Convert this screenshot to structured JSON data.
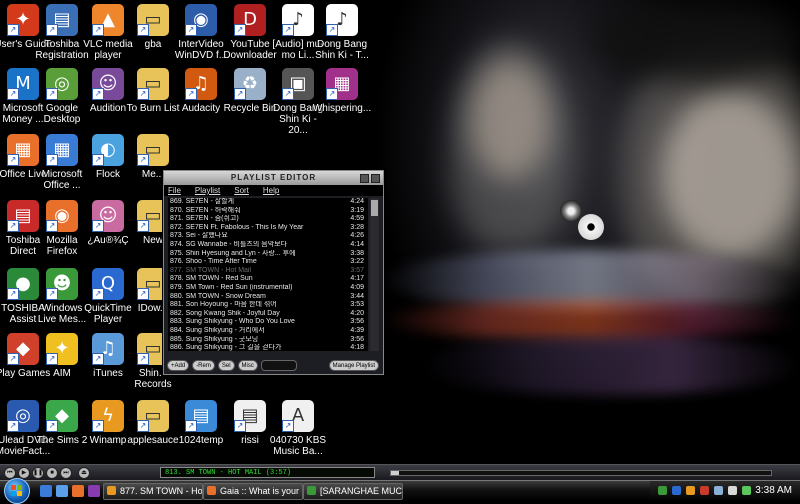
{
  "desktop": {
    "icons": [
      {
        "label": "User's Guide",
        "color": "#d33a1c",
        "glyph": "✦"
      },
      {
        "label": "Toshiba Registration",
        "color": "#3a6fb5",
        "glyph": "▤"
      },
      {
        "label": "VLC media player",
        "color": "#f0862b",
        "glyph": "▲"
      },
      {
        "label": "gba",
        "color": "#e7c35a",
        "glyph": "▭"
      },
      {
        "label": "InterVideo WinDVD f...",
        "color": "#2d5ca8",
        "glyph": "◉"
      },
      {
        "label": "YouTube Downloader",
        "color": "#b02020",
        "glyph": "D"
      },
      {
        "label": "[Audio] mu-mo Li...",
        "color": "#ffffff",
        "glyph": "♪"
      },
      {
        "label": "Dong Bang Shin Ki - T...",
        "color": "#ffffff",
        "glyph": "♪"
      },
      {
        "label": "Microsoft Money ...",
        "color": "#1a73c9",
        "glyph": "M"
      },
      {
        "label": "Google Desktop",
        "color": "#5a9e3a",
        "glyph": "◎"
      },
      {
        "label": "Audition",
        "color": "#7a4a9a",
        "glyph": "☺"
      },
      {
        "label": "To Burn List",
        "color": "#e7c35a",
        "glyph": "▭"
      },
      {
        "label": "Audacity",
        "color": "#d25a10",
        "glyph": "♫"
      },
      {
        "label": "Recycle Bin",
        "color": "#9ab0c8",
        "glyph": "♻"
      },
      {
        "label": "Dong Bang Shin Ki - 20...",
        "color": "#555555",
        "glyph": "▣"
      },
      {
        "label": "Whispering...",
        "color": "#a0308a",
        "glyph": "▦"
      },
      {
        "label": "Office Live",
        "color": "#e8702a",
        "glyph": "▦"
      },
      {
        "label": "Microsoft Office ...",
        "color": "#3a7bd5",
        "glyph": "▦"
      },
      {
        "label": "Flock",
        "color": "#4aa3df",
        "glyph": "◐"
      },
      {
        "label": "Me...",
        "color": "#e7c35a",
        "glyph": "▭"
      },
      {
        "label": "Toshiba Direct",
        "color": "#c82a2a",
        "glyph": "▤"
      },
      {
        "label": "Mozilla Firefox",
        "color": "#e8702a",
        "glyph": "◉"
      },
      {
        "label": "¿Au®¾Ç",
        "color": "#c96aa0",
        "glyph": "☺"
      },
      {
        "label": "New",
        "color": "#e7c35a",
        "glyph": "▭"
      },
      {
        "label": "TOSHIBA Assist",
        "color": "#2a8a3a",
        "glyph": "●"
      },
      {
        "label": "Windows Live Mes...",
        "color": "#3a9a3a",
        "glyph": "☻"
      },
      {
        "label": "QuickTime Player",
        "color": "#2a6ad0",
        "glyph": "Q"
      },
      {
        "label": "IDow...",
        "color": "#e7c35a",
        "glyph": "▭"
      },
      {
        "label": "Play Games",
        "color": "#d0402a",
        "glyph": "◆"
      },
      {
        "label": "AIM",
        "color": "#f0c020",
        "glyph": "✦"
      },
      {
        "label": "iTunes",
        "color": "#5a9ad8",
        "glyph": "♫"
      },
      {
        "label": "Shin... Records",
        "color": "#e7c35a",
        "glyph": "▭"
      },
      {
        "label": "Music Ban...",
        "color": "#e7c35a",
        "glyph": "▭"
      },
      {
        "label": "Ulead DVD MovieFact...",
        "color": "#2a5ab0",
        "glyph": "◎"
      },
      {
        "label": "The Sims 2",
        "color": "#3aa84a",
        "glyph": "◆"
      },
      {
        "label": "Winamp",
        "color": "#e89a20",
        "glyph": "ϟ"
      },
      {
        "label": "applesauce",
        "color": "#e7c35a",
        "glyph": "▭"
      },
      {
        "label": "1024temp",
        "color": "#3a8ad8",
        "glyph": "▤"
      },
      {
        "label": "rissi",
        "color": "#f0f0f0",
        "glyph": "▤"
      },
      {
        "label": "040730 KBS Music Ba...",
        "color": "#f0f0f0",
        "glyph": "A"
      }
    ]
  },
  "playlist": {
    "title": "PLAYLIST EDITOR",
    "menu": [
      "File",
      "Playlist",
      "Sort",
      "Help"
    ],
    "rows": [
      {
        "t": "869. SE7EN - 잘할게",
        "d": "4:24"
      },
      {
        "t": "870. SE7EN - 허락해줘",
        "d": "3:19"
      },
      {
        "t": "871. SE7EN - 숨(쉬고)",
        "d": "4:59"
      },
      {
        "t": "872. SE7EN Ft. Fabolous - This Is My Year",
        "d": "3:28"
      },
      {
        "t": "873. Sei - 잘했나요",
        "d": "4:26"
      },
      {
        "t": "874. SG Wannabe - 비틀즈의 음악보다",
        "d": "4:14"
      },
      {
        "t": "875. Shin Hyesung and Lyn - 사랑... 후에",
        "d": "3:38"
      },
      {
        "t": "876. Shoo - Time After Time",
        "d": "3:22"
      },
      {
        "t": "877. SM TOWN - Hot Mail",
        "d": "3:57",
        "current": true
      },
      {
        "t": "878. SM TOWN - Red Sun",
        "d": "4:17"
      },
      {
        "t": "879. SM Town - Red Sun (instrumental)",
        "d": "4:09"
      },
      {
        "t": "880. SM TOWN - Snow Dream",
        "d": "3:44"
      },
      {
        "t": "881. Son Hoyoung - 마음 한데 섞어",
        "d": "3:53"
      },
      {
        "t": "882. Song Kwang Shik - Joyful Day",
        "d": "4:20"
      },
      {
        "t": "883. Sung Shikyung - Who Do You Love",
        "d": "3:56"
      },
      {
        "t": "884. Sung Shikyung - 거리에서",
        "d": "4:39"
      },
      {
        "t": "885. Sung Shikyung - 굿모닝",
        "d": "3:56"
      },
      {
        "t": "886. Sung Shikyung - 그 길을 걷다가",
        "d": "4:18"
      }
    ],
    "buttons": [
      "+Add",
      "-Rem",
      "Sel",
      "Misc"
    ],
    "lcd": "",
    "manage": "Manage Playlist"
  },
  "player": {
    "display": "813. SM TOWN - HOT MAIL  (3:57)",
    "seek_fraction": 0.02
  },
  "taskbar": {
    "tasks": [
      {
        "label": "877. SM TOWN - Ho...",
        "color": "#e89a20"
      },
      {
        "label": "Gaia :: What is your ...",
        "color": "#e8702a"
      },
      {
        "label": "[SARANGHAE MUC...",
        "color": "#3a9a3a"
      }
    ],
    "clock": "3:38 AM"
  }
}
